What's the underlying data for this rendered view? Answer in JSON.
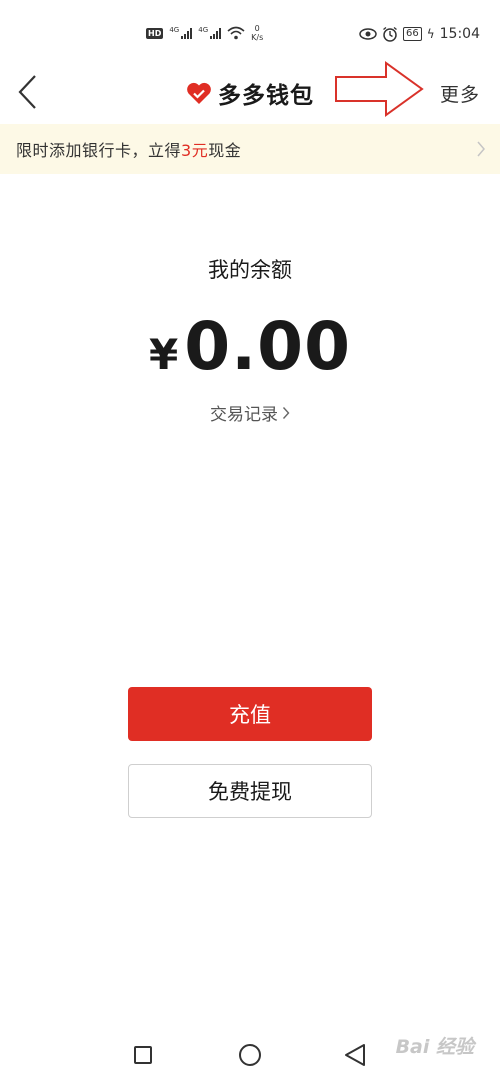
{
  "status_bar": {
    "hd": "HD",
    "sim1_tech": "4G",
    "sim2_tech": "4G",
    "speed_value": "0",
    "speed_unit": "K/s",
    "battery": "66",
    "time": "15:04"
  },
  "nav": {
    "title": "多多钱包",
    "more_label": "更多"
  },
  "promo": {
    "text_before": "限时添加银行卡，立得",
    "highlight": "3元",
    "text_after": "现金"
  },
  "balance": {
    "label": "我的余额",
    "currency": "¥",
    "amount": "0.00",
    "transactions_link": "交易记录"
  },
  "actions": {
    "recharge_label": "充值",
    "withdraw_label": "免费提现"
  },
  "watermark": "Bai 经验",
  "colors": {
    "accent": "#e02e24",
    "promo_bg": "#fdf9e6",
    "annotation_arrow": "#d9322a"
  }
}
